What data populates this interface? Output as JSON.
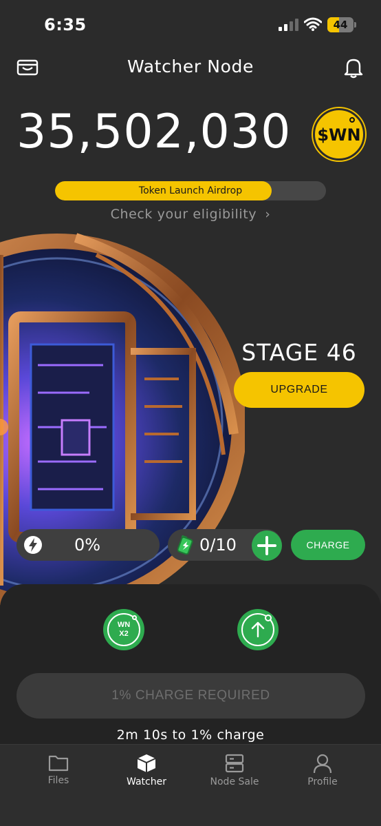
{
  "status_bar": {
    "time": "6:35",
    "battery_level": "44",
    "battery_fraction": 0.44
  },
  "header": {
    "title": "Watcher Node"
  },
  "balance": {
    "amount": "35,502,030",
    "token": "$WN"
  },
  "airdrop": {
    "label": "Token Launch Airdrop",
    "progress": 0.8,
    "link_text": "Check your eligibility"
  },
  "stage": {
    "title": "STAGE 46",
    "upgrade_label": "UPGRADE"
  },
  "charge": {
    "percent": "0%",
    "batteries": "0/10",
    "charge_label": "CHARGE"
  },
  "boosts": {
    "wn_label_line1": "WN",
    "wn_label_line2": "X2"
  },
  "action": {
    "button_label": "1% CHARGE REQUIRED",
    "timer": "2m 10s to 1% charge"
  },
  "tabs": [
    {
      "label": "Files",
      "icon": "folder-icon",
      "active": false
    },
    {
      "label": "Watcher",
      "icon": "cube-icon",
      "active": true
    },
    {
      "label": "Node Sale",
      "icon": "server-icon",
      "active": false
    },
    {
      "label": "Profile",
      "icon": "person-icon",
      "active": false
    }
  ],
  "colors": {
    "accent": "#f5c400",
    "green": "#2eab4f",
    "background": "#2b2b2b"
  }
}
